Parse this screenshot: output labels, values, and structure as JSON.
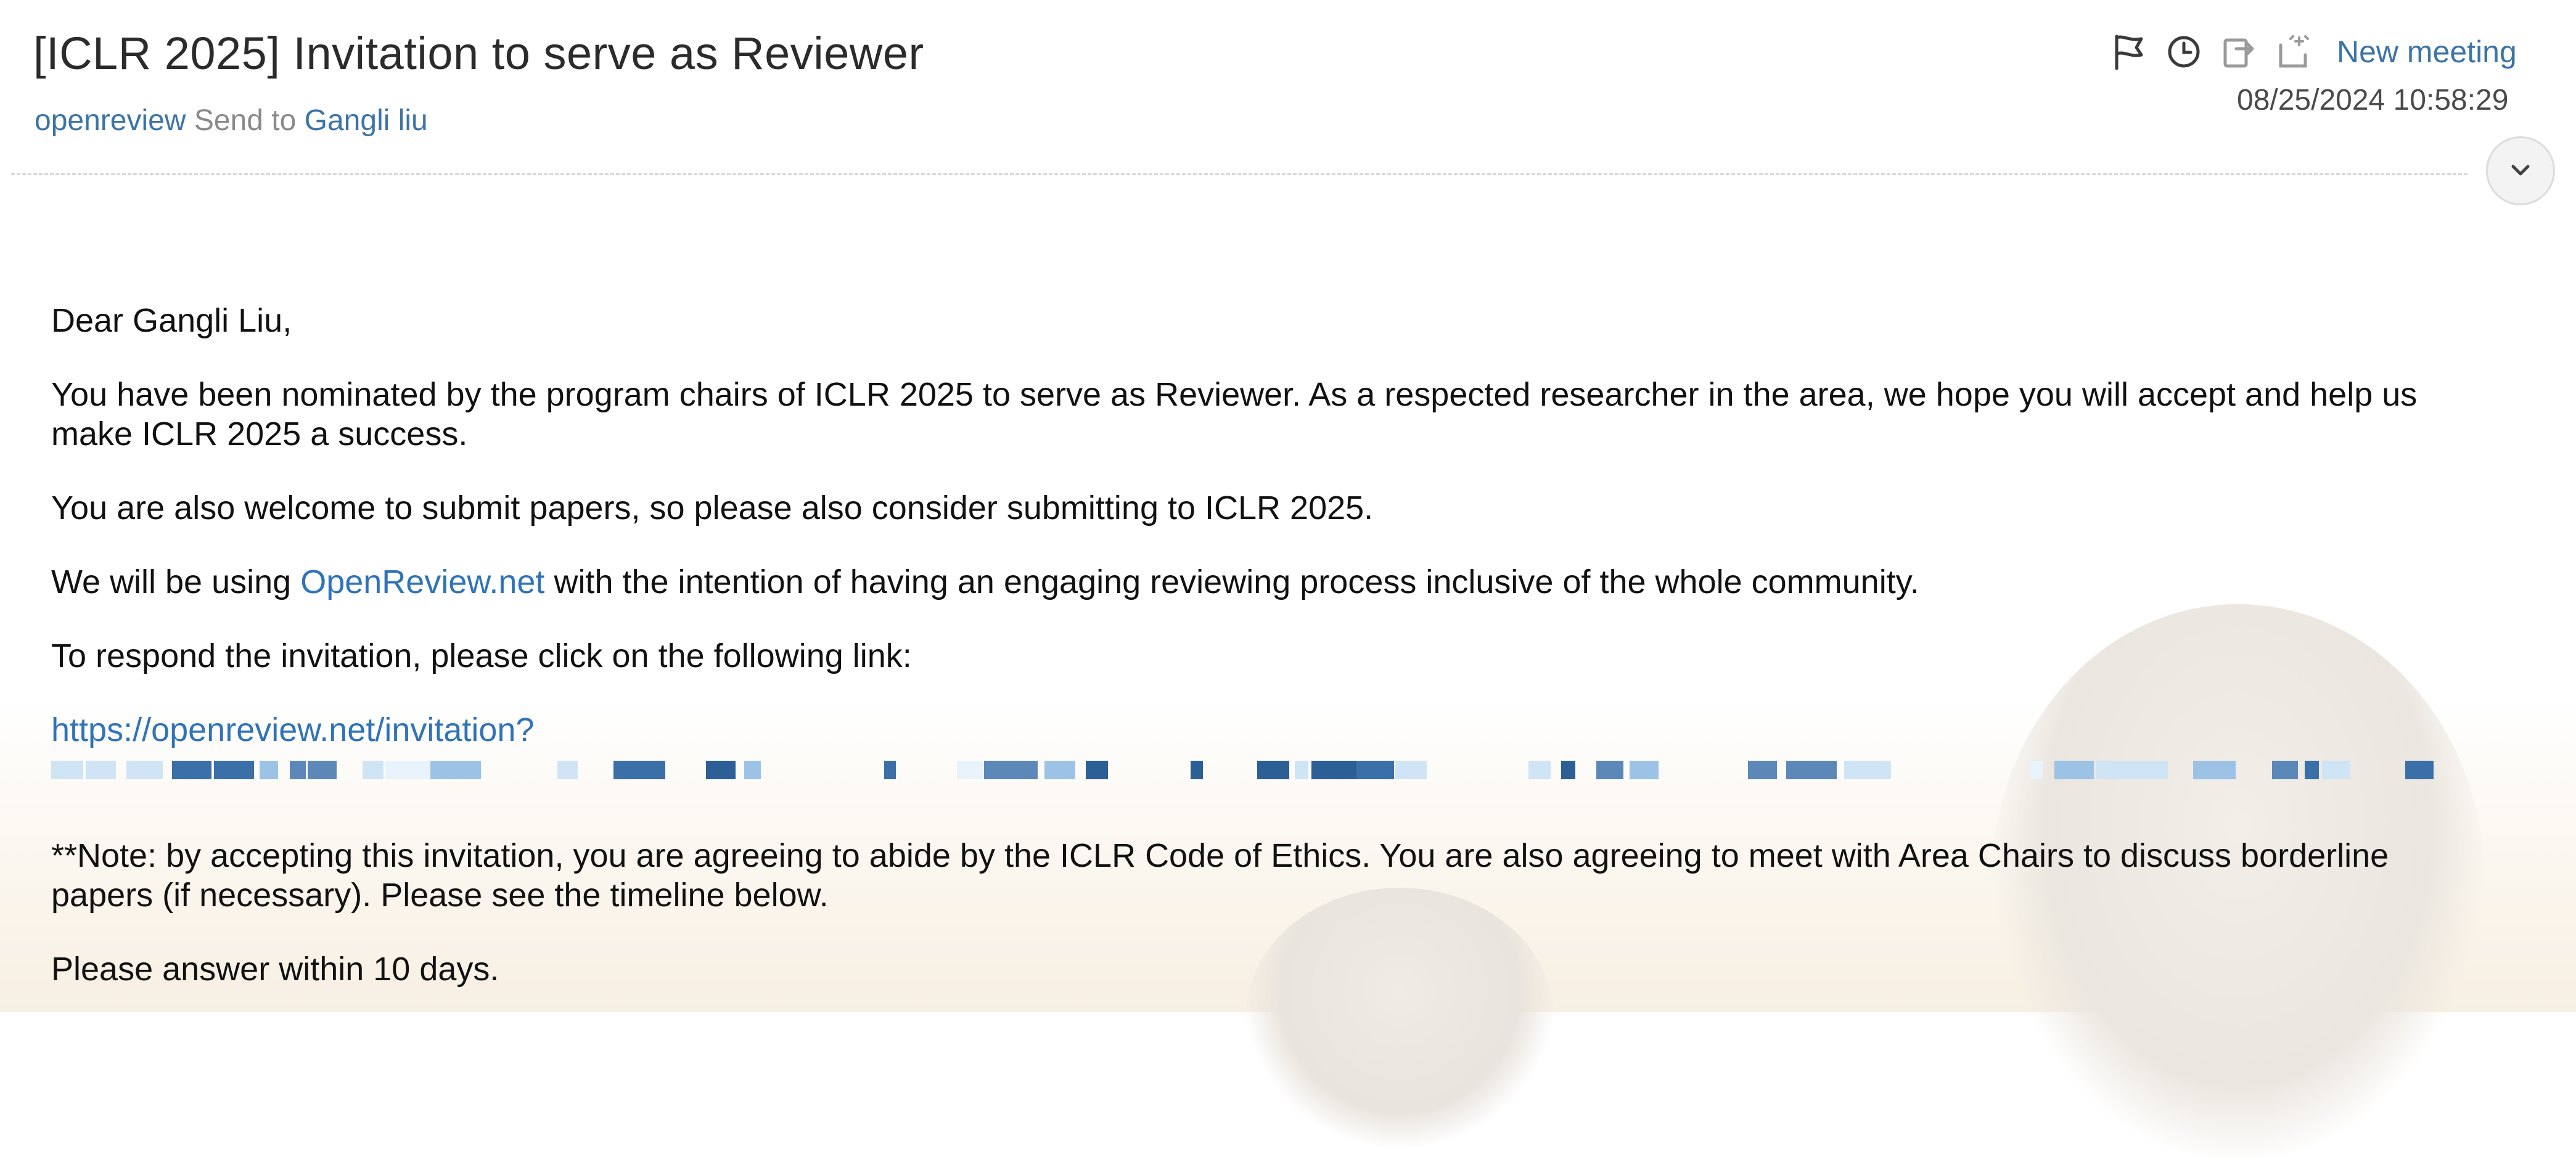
{
  "email": {
    "subject": "[ICLR 2025] Invitation to serve as Reviewer",
    "sender": "openreview",
    "send_to_label": "Send to",
    "recipient": "Gangli liu",
    "datetime": "08/25/2024 10:58:29"
  },
  "toolbar": {
    "icons": [
      "flag-icon",
      "clock-icon",
      "forward-icon",
      "schedule-icon"
    ],
    "new_meeting_label": "New meeting"
  },
  "body": {
    "greeting": "Dear Gangli Liu,",
    "p1": "You have been nominated by the program chairs of ICLR 2025 to serve as Reviewer. As a respected researcher in the area, we hope you will accept and help us make ICLR 2025 a success.",
    "p2": "You are also welcome to submit papers, so please also consider submitting to ICLR 2025.",
    "p3_before": "We will be using ",
    "p3_link": "OpenReview.net",
    "p3_after": " with the intention of having an engaging reviewing process inclusive of the whole community.",
    "p4": "To respond the invitation, please click on the following link:",
    "invitation_link": "https://openreview.net/invitation?",
    "p5": "**Note: by accepting this invitation, you are agreeing to abide by the ICLR Code of Ethics. You are also agreeing to meet with Area Chairs to discuss borderline papers (if necessary). Please see the timeline below.",
    "p6": "Please answer within 10 days."
  },
  "colors": {
    "link": "#2f73b8",
    "header_link": "#3c74a6",
    "redaction_dark": "#2b5f96",
    "redaction_light": "#9cc3e6"
  }
}
